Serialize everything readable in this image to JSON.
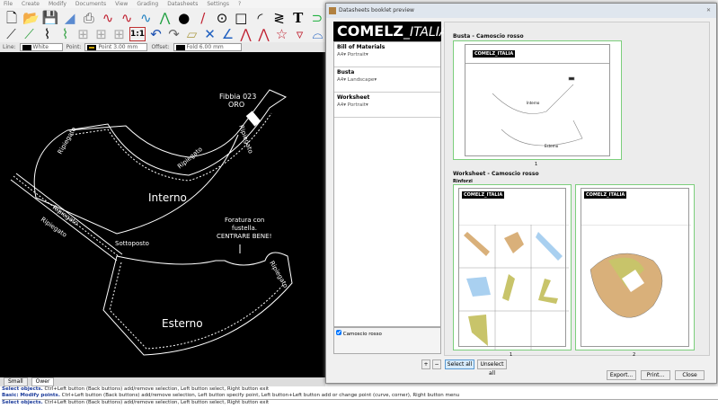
{
  "menu": [
    "File",
    "Create",
    "Modify",
    "Documents",
    "View",
    "Grading",
    "Datasheets",
    "Settings",
    "?"
  ],
  "toolbar": {
    "one_to_one": "1:1",
    "text_tool": "T"
  },
  "options": {
    "line_label": "Line:",
    "line_value": "White",
    "point_label": "Point:",
    "point_value": "Point 3.00 mm",
    "offset_label": "Offset:",
    "offset_value": "Fold 6.00 mm"
  },
  "canvas": {
    "fibbia": "Fibbia 023",
    "oro": "ORO",
    "ripiegato": "Ripiegato",
    "interno": "Interno",
    "sottoposto": "Sottoposto",
    "foratura1": "Foratura con",
    "foratura2": "fustella.",
    "foratura3": "CENTRARE BENE!",
    "esterno": "Esterno"
  },
  "tabs": [
    "Small",
    "Ower"
  ],
  "status": {
    "line1_a": "Select objects.",
    "line1_b": "Ctrl+Left button (Back buttons) add/remove selection, Left button select, Right button exit",
    "line2_a": "Basic: Modify points.",
    "line2_b": "Ctrl+Left button (Back buttons) add/remove selection, Left button specify point, Left button+Left button add or change point (curve, corner), Right button menu",
    "line3_a": "Select objects.",
    "line3_b": "Ctrl+Left button (Back buttons) add/remove selection, Left button select, Right button exit"
  },
  "dialog": {
    "title": "Datasheets booklet preview",
    "logo_main": "COMELZ",
    "logo_sub": "_ITALIA",
    "documents": [
      {
        "name": "Bill of Materials",
        "format": "A4▾ Portrait▾"
      },
      {
        "name": "Busta",
        "format": "A4▾ Landscape▾"
      },
      {
        "name": "Worksheet",
        "format": "A4▾ Portrait▾"
      }
    ],
    "material": "Camoscio rosso",
    "material_checked": true,
    "sections": [
      {
        "title": "Busta - Camoscio rosso",
        "pages": [
          "1"
        ]
      },
      {
        "title": "Worksheet - Camoscio rosso",
        "subtitle": "Rinforzi",
        "pages": [
          "1",
          "2"
        ]
      }
    ],
    "mini_logo": "COMELZ_ITALIA",
    "mini_labels": {
      "interno": "Interno",
      "esterno": "Esterno"
    },
    "buttons": {
      "add": "+",
      "remove": "−",
      "select_all": "Select all",
      "unselect_all": "Unselect all",
      "export": "Export...",
      "print": "Print...",
      "close": "Close"
    }
  },
  "colors": {
    "canvas": "#000000",
    "page_border": "#7ccf7c",
    "piece_tan": "#d9b07a",
    "piece_blue": "#a9d0f0",
    "piece_olive": "#c8c46a"
  }
}
